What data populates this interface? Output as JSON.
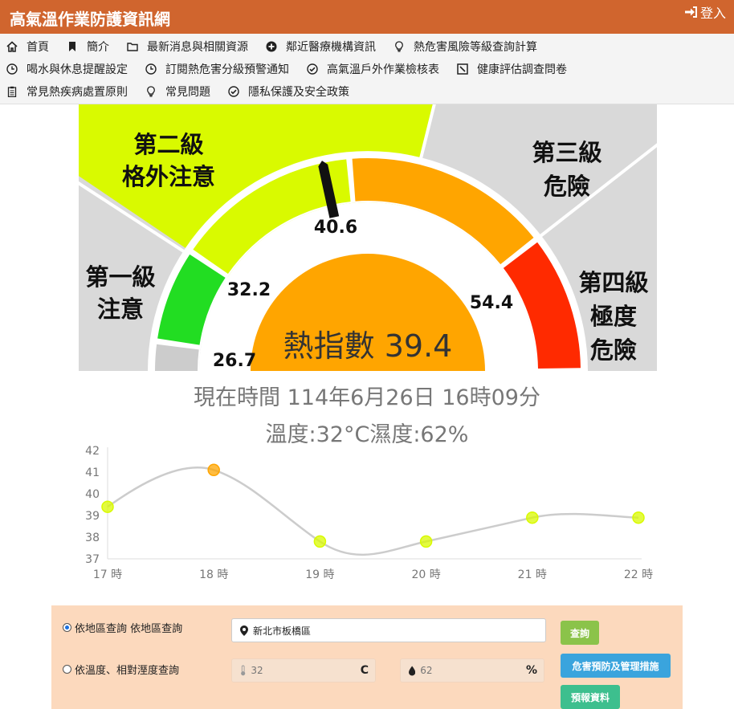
{
  "header": {
    "title": "高氣溫作業防護資訊網",
    "login": "登入"
  },
  "nav": {
    "rows": [
      [
        {
          "label": "首頁",
          "icon": "home-icon"
        },
        {
          "label": "簡介",
          "icon": "bookmark-icon"
        },
        {
          "label": "最新消息與相關資源",
          "icon": "folder-icon"
        },
        {
          "label": "鄰近醫療機構資訊",
          "icon": "plus-circle-icon"
        },
        {
          "label": "熱危害風險等級查詢計算",
          "icon": "lightbulb-icon"
        }
      ],
      [
        {
          "label": "喝水與休息提醒設定",
          "icon": "clock-icon"
        },
        {
          "label": "訂閱熱危害分級預警通知",
          "icon": "clock-icon"
        },
        {
          "label": "高氣溫戶外作業檢核表",
          "icon": "check-circle-icon"
        },
        {
          "label": "健康評估調查問卷",
          "icon": "edit-box-icon"
        }
      ],
      [
        {
          "label": "常見熱疾病處置原則",
          "icon": "clipboard-icon"
        },
        {
          "label": "常見問題",
          "icon": "lightbulb-icon"
        },
        {
          "label": "隱私保護及安全政策",
          "icon": "check-circle-icon"
        }
      ]
    ]
  },
  "gauge": {
    "levels": [
      {
        "line1": "第一級",
        "line2": "注意",
        "color": "#22dd22"
      },
      {
        "line1": "第二級",
        "line2": "格外注意",
        "color": "#d9fa00"
      },
      {
        "line1": "第三級",
        "line2": "危險",
        "color": "#ffa500"
      },
      {
        "line1": "第四級",
        "line2": "極度",
        "line3": "危險",
        "color": "#ff2a00"
      }
    ],
    "thresholds": [
      "26.7",
      "32.2",
      "40.6",
      "54.4"
    ],
    "heat_index_label": "熱指數 39.4",
    "heat_index_value": 39.4,
    "center_color": "#ffa500"
  },
  "current": {
    "time_text": "現在時間 114年6月26日 16時09分",
    "weather_text": "溫度:32°C濕度:62%"
  },
  "chart_data": {
    "type": "line",
    "categories": [
      "17 時",
      "18 時",
      "19 時",
      "20 時",
      "21 時",
      "22 時"
    ],
    "values": [
      39.4,
      41.1,
      37.8,
      37.8,
      38.9,
      38.9
    ],
    "point_colors": [
      "#d9fa00",
      "#ffa500",
      "#d9fa00",
      "#d9fa00",
      "#d9fa00",
      "#d9fa00"
    ],
    "yticks": [
      37,
      38,
      39,
      40,
      41,
      42
    ],
    "ylim": [
      37,
      42
    ],
    "title": "",
    "xlabel": "",
    "ylabel": "",
    "grid": false,
    "line_color": "#cccccc"
  },
  "form": {
    "opt_area": "依地區查詢 依地區查詢",
    "opt_temp": "依溫度、相對溼度查詢",
    "area_value": "新北市板橋區",
    "temp_placeholder": "32",
    "temp_unit": "C",
    "humid_placeholder": "62",
    "humid_unit": "%",
    "btn_query": "查詢",
    "btn_measures": "危害預防及管理措施",
    "btn_forecast": "預報資料",
    "colors": {
      "query": "#8bc34a",
      "measures": "#3aa4dd",
      "forecast": "#3dbf8e"
    }
  }
}
